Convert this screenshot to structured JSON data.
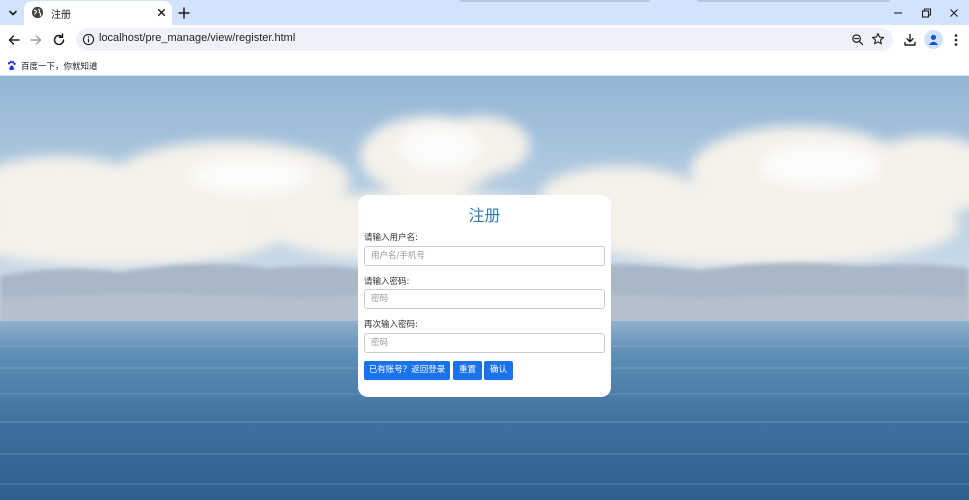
{
  "browser": {
    "tab_title": "注册",
    "url": "localhost/pre_manage/view/register.html",
    "bookmark_label": "百度一下，你就知道"
  },
  "page": {
    "title": "注册",
    "username": {
      "label": "请输入用户名:",
      "placeholder": "用户名/手机号"
    },
    "password": {
      "label": "请输入密码:",
      "placeholder": "密码"
    },
    "password_confirm": {
      "label": "再次输入密码:",
      "placeholder": "密码"
    },
    "buttons": {
      "back_to_login": "已有账号？返回登录",
      "reset": "重置",
      "confirm": "确认"
    },
    "colors": {
      "title": "#337ab7",
      "button": "#1a73e8"
    }
  }
}
